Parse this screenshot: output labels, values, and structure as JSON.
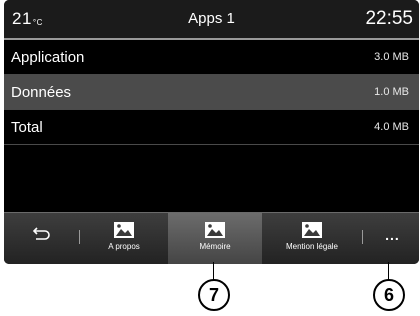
{
  "status": {
    "temperature": "21",
    "temperature_unit": "°C",
    "title": "Apps 1",
    "time": "22:55"
  },
  "rows": [
    {
      "label": "Application",
      "value": "3.0 MB"
    },
    {
      "label": "Données",
      "value": "1.0 MB"
    },
    {
      "label": "Total",
      "value": "4.0 MB"
    }
  ],
  "toolbar": {
    "about_label": "A propos",
    "memory_label": "Mémoire",
    "legal_label": "Mention légale",
    "more_label": "...",
    "active_tab": "Mémoire"
  },
  "callouts": {
    "memory_number": "7",
    "more_number": "6"
  },
  "colors": {
    "screen_bg": "#000000",
    "row_highlight": "#4b4b4b",
    "text": "#ffffff"
  }
}
